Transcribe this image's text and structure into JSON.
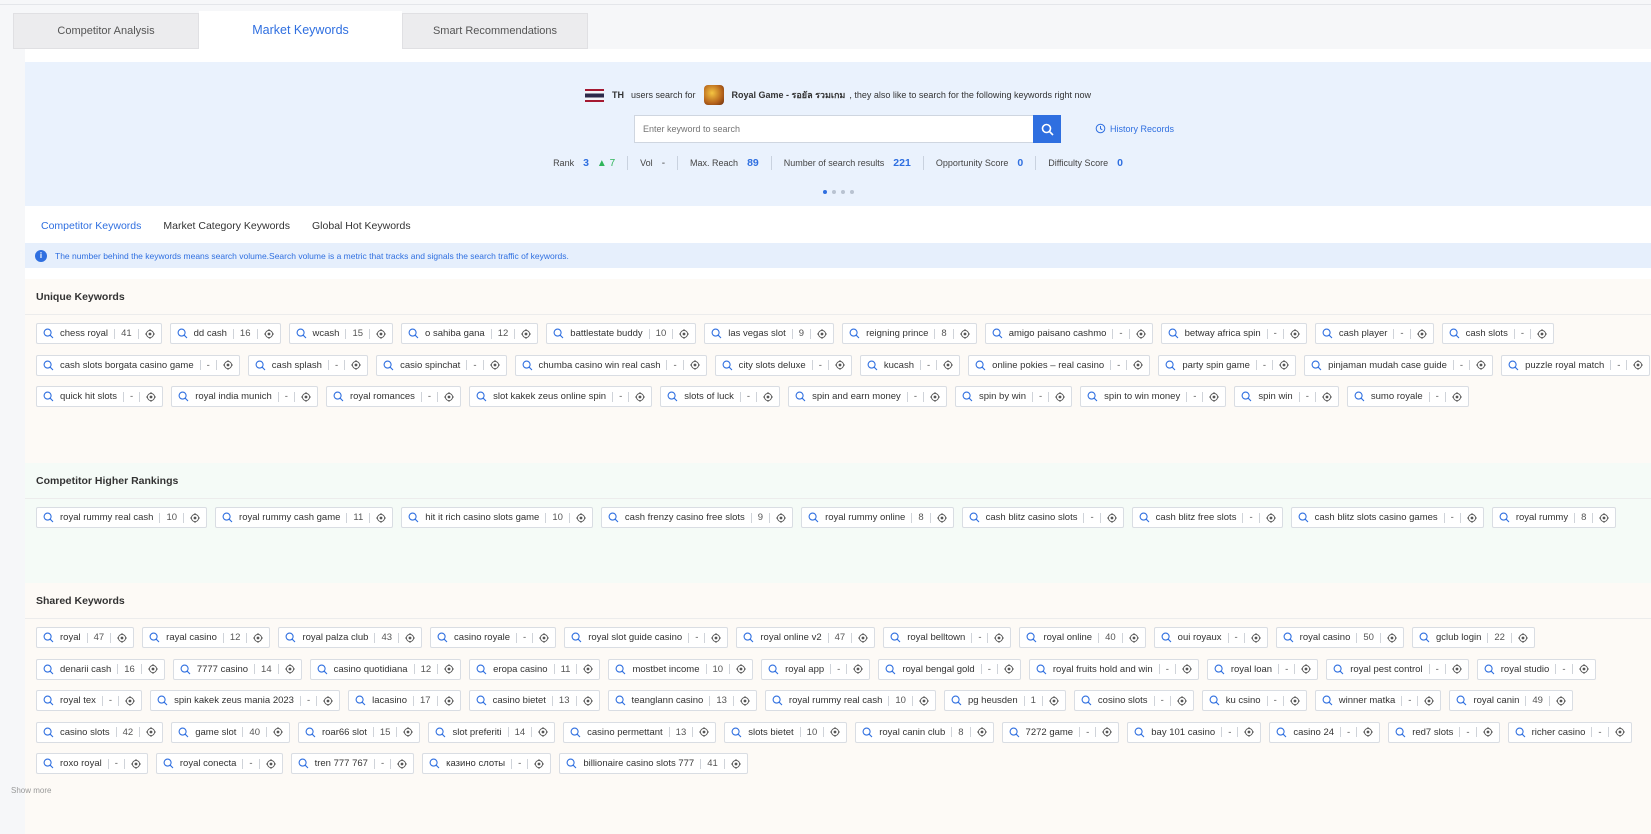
{
  "top_tabs": [
    "Competitor Analysis",
    "Market Keywords",
    "Smart Recommendations"
  ],
  "hero": {
    "country_code": "TH",
    "text_before": "users search for",
    "app_name": "Royal Game - รอยัล รวมเกม",
    "text_after": ", they also like to search for the following keywords right now",
    "search_placeholder": "Enter keyword to search",
    "history_label": "History Records",
    "stats": [
      {
        "label": "Rank",
        "value": "3",
        "change": "▲ 7"
      },
      {
        "label": "Vol",
        "value": "-"
      },
      {
        "label": "Max. Reach",
        "value": "89"
      },
      {
        "label": "Number of search results",
        "value": "221"
      },
      {
        "label": "Opportunity Score",
        "value": "0"
      },
      {
        "label": "Difficulty Score",
        "value": "0"
      }
    ]
  },
  "sub_tabs": [
    "Competitor Keywords",
    "Market Category Keywords",
    "Global Hot Keywords"
  ],
  "info_text": "The number behind the keywords means search volume.Search volume is a metric that tracks and signals the search traffic of keywords.",
  "sections": {
    "unique": {
      "title": "Unique Keywords",
      "keywords": [
        {
          "k": "chess royal",
          "v": "41"
        },
        {
          "k": "dd cash",
          "v": "16"
        },
        {
          "k": "wcash",
          "v": "15"
        },
        {
          "k": "o sahiba gana",
          "v": "12"
        },
        {
          "k": "battlestate buddy",
          "v": "10"
        },
        {
          "k": "las vegas slot",
          "v": "9"
        },
        {
          "k": "reigning prince",
          "v": "8"
        },
        {
          "k": "amigo paisano cashmo",
          "v": "-"
        },
        {
          "k": "betway africa spin",
          "v": "-"
        },
        {
          "k": "cash player",
          "v": "-"
        },
        {
          "k": "cash slots",
          "v": "-"
        },
        {
          "k": "cash slots borgata casino game",
          "v": "-"
        },
        {
          "k": "cash splash",
          "v": "-"
        },
        {
          "k": "casio spinchat",
          "v": "-"
        },
        {
          "k": "chumba casino win real cash",
          "v": "-"
        },
        {
          "k": "city slots deluxe",
          "v": "-"
        },
        {
          "k": "kucash",
          "v": "-"
        },
        {
          "k": "online pokies – real casino",
          "v": "-"
        },
        {
          "k": "party spin game",
          "v": "-"
        },
        {
          "k": "pinjaman mudah case guide",
          "v": "-"
        },
        {
          "k": "puzzle royal match",
          "v": "-"
        },
        {
          "k": "quick hit slots",
          "v": "-"
        },
        {
          "k": "royal india munich",
          "v": "-"
        },
        {
          "k": "royal romances",
          "v": "-"
        },
        {
          "k": "slot kakek zeus online spin",
          "v": "-"
        },
        {
          "k": "slots of luck",
          "v": "-"
        },
        {
          "k": "spin and earn money",
          "v": "-"
        },
        {
          "k": "spin by win",
          "v": "-"
        },
        {
          "k": "spin to win money",
          "v": "-"
        },
        {
          "k": "spin win",
          "v": "-"
        },
        {
          "k": "sumo royale",
          "v": "-"
        }
      ]
    },
    "higher": {
      "title": "Competitor Higher Rankings",
      "keywords": [
        {
          "k": "royal rummy real cash",
          "v": "10"
        },
        {
          "k": "royal rummy cash game",
          "v": "11"
        },
        {
          "k": "hit it rich casino slots game",
          "v": "10"
        },
        {
          "k": "cash frenzy casino free slots",
          "v": "9"
        },
        {
          "k": "royal rummy online",
          "v": "8"
        },
        {
          "k": "cash blitz casino slots",
          "v": "-"
        },
        {
          "k": "cash blitz free slots",
          "v": "-"
        },
        {
          "k": "cash blitz slots casino games",
          "v": "-"
        },
        {
          "k": "royal rummy",
          "v": "8"
        }
      ]
    },
    "shared": {
      "title": "Shared Keywords",
      "keywords": [
        {
          "k": "royal",
          "v": "47"
        },
        {
          "k": "rayal casino",
          "v": "12"
        },
        {
          "k": "royal palza club",
          "v": "43"
        },
        {
          "k": "casino royale",
          "v": "-"
        },
        {
          "k": "royal slot guide casino",
          "v": "-"
        },
        {
          "k": "royal online v2",
          "v": "47"
        },
        {
          "k": "royal belltown",
          "v": "-"
        },
        {
          "k": "royal online",
          "v": "40"
        },
        {
          "k": "oui royaux",
          "v": "-"
        },
        {
          "k": "royal casino",
          "v": "50"
        },
        {
          "k": "gclub login",
          "v": "22"
        },
        {
          "k": "denarii cash",
          "v": "16"
        },
        {
          "k": "7777 casino",
          "v": "14"
        },
        {
          "k": "casino quotidiana",
          "v": "12"
        },
        {
          "k": "eropa casino",
          "v": "11"
        },
        {
          "k": "mostbet income",
          "v": "10"
        },
        {
          "k": "royal app",
          "v": "-"
        },
        {
          "k": "royal bengal gold",
          "v": "-"
        },
        {
          "k": "royal fruits hold and win",
          "v": "-"
        },
        {
          "k": "royal loan",
          "v": "-"
        },
        {
          "k": "royal pest control",
          "v": "-"
        },
        {
          "k": "royal studio",
          "v": "-"
        },
        {
          "k": "royal tex",
          "v": "-"
        },
        {
          "k": "spin kakek zeus mania 2023",
          "v": "-"
        },
        {
          "k": "lacasino",
          "v": "17"
        },
        {
          "k": "casino bietet",
          "v": "13"
        },
        {
          "k": "teanglann casino",
          "v": "13"
        },
        {
          "k": "royal rummy real cash",
          "v": "10"
        },
        {
          "k": "pg heusden",
          "v": "1"
        },
        {
          "k": "cosino slots",
          "v": "-"
        },
        {
          "k": "ku csino",
          "v": "-"
        },
        {
          "k": "winner matka",
          "v": "-"
        },
        {
          "k": "royal canin",
          "v": "49"
        },
        {
          "k": "casino slots",
          "v": "42"
        },
        {
          "k": "game slot",
          "v": "40"
        },
        {
          "k": "roar66 slot",
          "v": "15"
        },
        {
          "k": "slot preferiti",
          "v": "14"
        },
        {
          "k": "casino permettant",
          "v": "13"
        },
        {
          "k": "slots bietet",
          "v": "10"
        },
        {
          "k": "royal canin club",
          "v": "8"
        },
        {
          "k": "7272 game",
          "v": "-"
        },
        {
          "k": "bay 101 casino",
          "v": "-"
        },
        {
          "k": "casino 24",
          "v": "-"
        },
        {
          "k": "red7 slots",
          "v": "-"
        },
        {
          "k": "richer casino",
          "v": "-"
        },
        {
          "k": "roxo royal",
          "v": "-"
        },
        {
          "k": "royal conecta",
          "v": "-"
        },
        {
          "k": "tren 777 767",
          "v": "-"
        },
        {
          "k": "казино слоты",
          "v": "-"
        },
        {
          "k": "billionaire casino slots 777",
          "v": "41"
        }
      ]
    }
  },
  "show_more": "Show more",
  "colors": {
    "accent": "#2f6fe0",
    "up": "#2fb55a",
    "hero_bg": "#eaf2fd"
  }
}
